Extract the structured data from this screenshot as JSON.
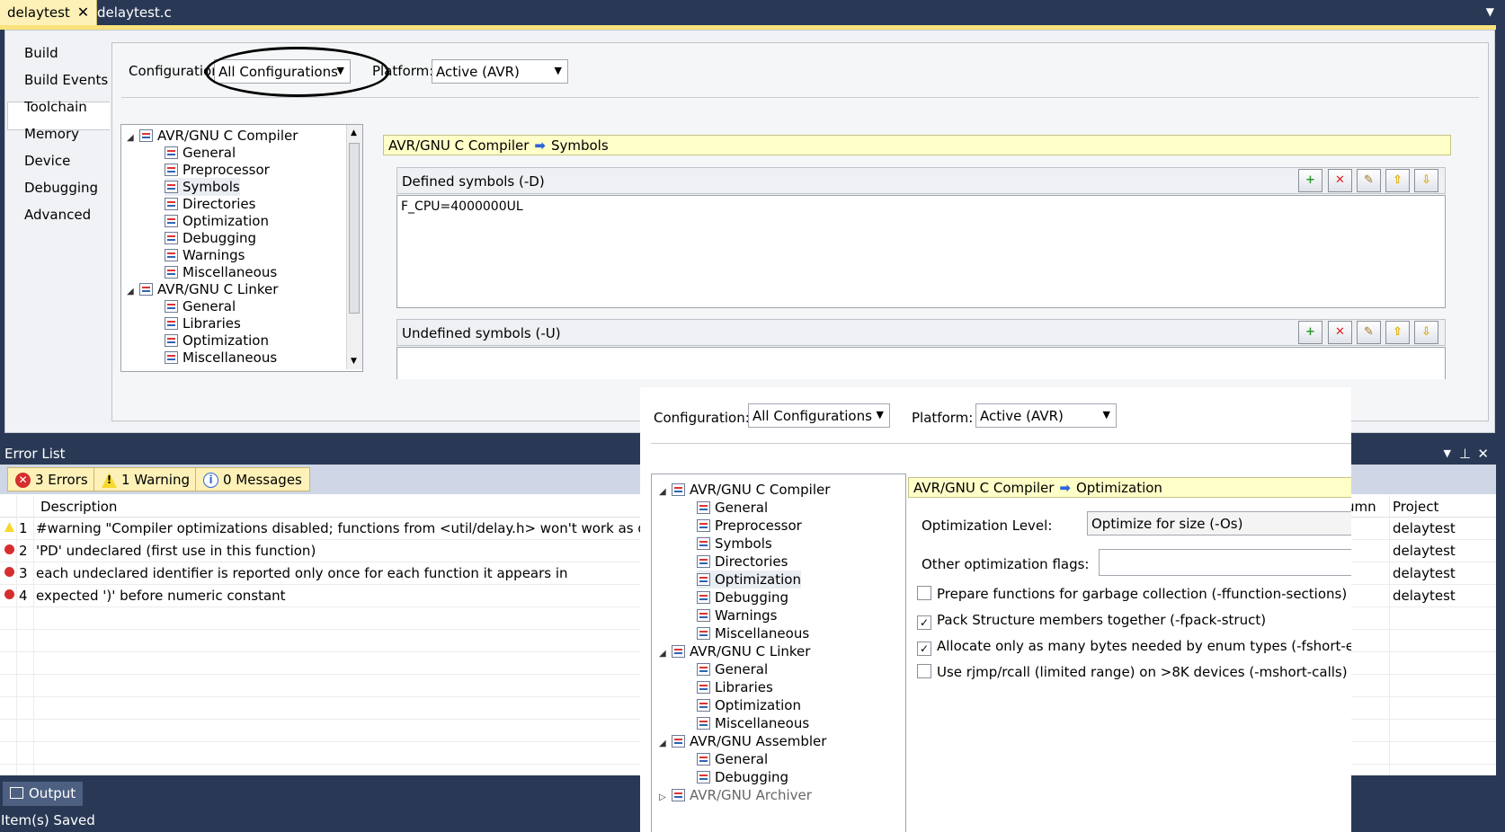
{
  "tabs": {
    "active_tab": "delaytest",
    "inactive_tab": "delaytest.c",
    "overflow_icon": "chevron-down-icon"
  },
  "sidebar": {
    "items": [
      {
        "label": "Build"
      },
      {
        "label": "Build Events"
      },
      {
        "label": "Toolchain"
      },
      {
        "label": "Memory"
      },
      {
        "label": "Device"
      },
      {
        "label": "Debugging"
      },
      {
        "label": "Advanced"
      }
    ],
    "selected": "Toolchain"
  },
  "config": {
    "configuration_label": "Configuration:",
    "configuration_value": "All Configurations",
    "platform_label": "Platform:",
    "platform_value": "Active (AVR)"
  },
  "tree": {
    "items": [
      {
        "label": "AVR/GNU C Compiler"
      },
      {
        "label": "General"
      },
      {
        "label": "Preprocessor"
      },
      {
        "label": "Symbols"
      },
      {
        "label": "Directories"
      },
      {
        "label": "Optimization"
      },
      {
        "label": "Debugging"
      },
      {
        "label": "Warnings"
      },
      {
        "label": "Miscellaneous"
      },
      {
        "label": "AVR/GNU C Linker"
      },
      {
        "label": "General"
      },
      {
        "label": "Libraries"
      },
      {
        "label": "Optimization"
      },
      {
        "label": "Miscellaneous"
      }
    ]
  },
  "symbols_panel": {
    "breadcrumb_root": "AVR/GNU C Compiler",
    "breadcrumb_leaf": "Symbols",
    "defined_header": "Defined symbols (-D)",
    "defined_values": "F_CPU=4000000UL",
    "undefined_header": "Undefined symbols (-U)"
  },
  "error_list": {
    "title": "Error List",
    "errors_chip": "3 Errors",
    "warnings_chip": "1 Warning",
    "messages_chip": "0 Messages",
    "col_description": "Description",
    "col_column": "umn",
    "col_project": "Project",
    "rows": [
      {
        "num": "1",
        "type": "warning",
        "desc": "#warning \"Compiler optimizations disabled; functions from <util/delay.h> won't work as designed\"",
        "project": "delaytest"
      },
      {
        "num": "2",
        "type": "error",
        "desc": "'PD' undeclared (first use in this function)",
        "project": "delaytest"
      },
      {
        "num": "3",
        "type": "error",
        "desc": "each undeclared identifier is reported only once for each function it appears in",
        "project": "delaytest"
      },
      {
        "num": "4",
        "type": "error",
        "desc": "expected ')' before numeric constant",
        "project": "delaytest"
      }
    ]
  },
  "output": {
    "tab_label": "Output"
  },
  "status": {
    "text": "Item(s) Saved"
  },
  "overlay": {
    "configuration_label": "Configuration:",
    "configuration_value": "All Configurations",
    "platform_label": "Platform:",
    "platform_value": "Active (AVR)",
    "tree": [
      {
        "label": "AVR/GNU C Compiler"
      },
      {
        "label": "General"
      },
      {
        "label": "Preprocessor"
      },
      {
        "label": "Symbols"
      },
      {
        "label": "Directories"
      },
      {
        "label": "Optimization"
      },
      {
        "label": "Debugging"
      },
      {
        "label": "Warnings"
      },
      {
        "label": "Miscellaneous"
      },
      {
        "label": "AVR/GNU C Linker"
      },
      {
        "label": "General"
      },
      {
        "label": "Libraries"
      },
      {
        "label": "Optimization"
      },
      {
        "label": "Miscellaneous"
      },
      {
        "label": "AVR/GNU Assembler"
      },
      {
        "label": "General"
      },
      {
        "label": "Debugging"
      },
      {
        "label": "AVR/GNU Archiver"
      }
    ],
    "breadcrumb_root": "AVR/GNU C Compiler",
    "breadcrumb_leaf": "Optimization",
    "opt_level_label": "Optimization Level:",
    "opt_level_value": "Optimize for size (-Os)",
    "other_flags_label": "Other optimization flags:",
    "checks": [
      {
        "label": "Prepare functions for garbage collection (-ffunction-sections)",
        "checked": false
      },
      {
        "label": "Pack Structure members together (-fpack-struct)",
        "checked": true
      },
      {
        "label": "Allocate only as many bytes needed by enum types (-fshort-enums)",
        "checked": true
      },
      {
        "label": "Use rjmp/rcall (limited range) on >8K devices (-mshort-calls)",
        "checked": false
      }
    ]
  }
}
